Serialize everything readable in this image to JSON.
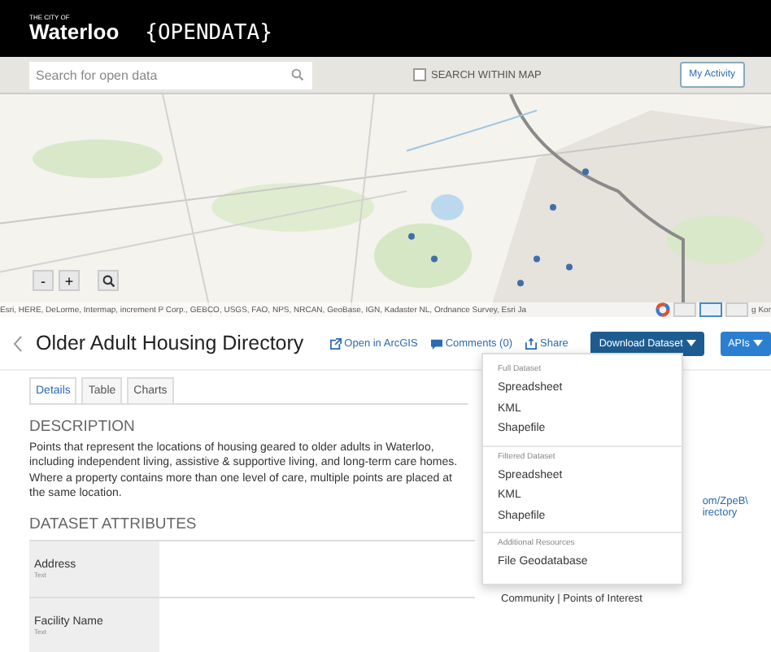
{
  "header": {
    "city_label": "THE CITY OF",
    "city_name": "Waterloo",
    "site_name": "{OPENDATA}"
  },
  "search": {
    "placeholder": "Search for open data"
  },
  "search_within_map": {
    "label": "SEARCH WITHIN MAP",
    "checked": false
  },
  "my_activity": "My Activity",
  "map": {
    "kind": "picture",
    "zoom_out": "-",
    "zoom_in": "+",
    "attribution": "Esri, HERE, DeLorme, Intermap, increment P Corp., GEBCO, USGS, FAO, NPS, NRCAN, GeoBase, IGN, Kadaster NL, Ordnance Survey, Esri Ja",
    "attribution_tail": "g Kor"
  },
  "dataset": {
    "title": "Older Adult Housing Directory",
    "actions": [
      "Open in ArcGIS",
      "Comments (0)",
      "Share"
    ],
    "download_button": "Download Dataset",
    "apis_button": "APIs"
  },
  "tabs": [
    {
      "label": "Details",
      "selected": true
    },
    {
      "label": "Table",
      "selected": false
    },
    {
      "label": "Charts",
      "selected": false
    }
  ],
  "description": {
    "heading": "DESCRIPTION",
    "text": "Points that represent the locations of housing geared to older adults in Waterloo, including independent living, assistive & supportive living, and long-term care homes. Where a property contains more than one level of care, multiple points are placed at the same location."
  },
  "attributes": {
    "heading": "DATASET ATTRIBUTES",
    "rows": [
      {
        "name": "Address",
        "type": "Text"
      },
      {
        "name": "Facility Name",
        "type": "Text"
      }
    ]
  },
  "side_panel": {
    "link_lines": [
      "om/ZpeB\\",
      "irectory"
    ],
    "tags": "Community | Points of Interest"
  },
  "download_menu": {
    "sections": [
      {
        "heading": "Full Dataset",
        "items": [
          "Spreadsheet",
          "KML",
          "Shapefile"
        ]
      },
      {
        "heading": "Filtered Dataset",
        "items": [
          "Spreadsheet",
          "KML",
          "Shapefile"
        ]
      },
      {
        "heading": "Additional Resources",
        "items": [
          "File Geodatabase"
        ]
      }
    ]
  }
}
